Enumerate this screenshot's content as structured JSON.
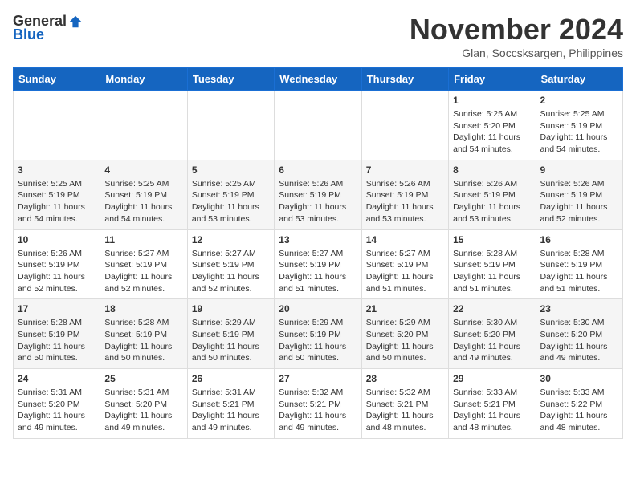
{
  "header": {
    "logo_general": "General",
    "logo_blue": "Blue",
    "month_title": "November 2024",
    "location": "Glan, Soccsksargen, Philippines"
  },
  "weekdays": [
    "Sunday",
    "Monday",
    "Tuesday",
    "Wednesday",
    "Thursday",
    "Friday",
    "Saturday"
  ],
  "weeks": [
    [
      {
        "day": "",
        "info": ""
      },
      {
        "day": "",
        "info": ""
      },
      {
        "day": "",
        "info": ""
      },
      {
        "day": "",
        "info": ""
      },
      {
        "day": "",
        "info": ""
      },
      {
        "day": "1",
        "info": "Sunrise: 5:25 AM\nSunset: 5:20 PM\nDaylight: 11 hours\nand 54 minutes."
      },
      {
        "day": "2",
        "info": "Sunrise: 5:25 AM\nSunset: 5:19 PM\nDaylight: 11 hours\nand 54 minutes."
      }
    ],
    [
      {
        "day": "3",
        "info": "Sunrise: 5:25 AM\nSunset: 5:19 PM\nDaylight: 11 hours\nand 54 minutes."
      },
      {
        "day": "4",
        "info": "Sunrise: 5:25 AM\nSunset: 5:19 PM\nDaylight: 11 hours\nand 54 minutes."
      },
      {
        "day": "5",
        "info": "Sunrise: 5:25 AM\nSunset: 5:19 PM\nDaylight: 11 hours\nand 53 minutes."
      },
      {
        "day": "6",
        "info": "Sunrise: 5:26 AM\nSunset: 5:19 PM\nDaylight: 11 hours\nand 53 minutes."
      },
      {
        "day": "7",
        "info": "Sunrise: 5:26 AM\nSunset: 5:19 PM\nDaylight: 11 hours\nand 53 minutes."
      },
      {
        "day": "8",
        "info": "Sunrise: 5:26 AM\nSunset: 5:19 PM\nDaylight: 11 hours\nand 53 minutes."
      },
      {
        "day": "9",
        "info": "Sunrise: 5:26 AM\nSunset: 5:19 PM\nDaylight: 11 hours\nand 52 minutes."
      }
    ],
    [
      {
        "day": "10",
        "info": "Sunrise: 5:26 AM\nSunset: 5:19 PM\nDaylight: 11 hours\nand 52 minutes."
      },
      {
        "day": "11",
        "info": "Sunrise: 5:27 AM\nSunset: 5:19 PM\nDaylight: 11 hours\nand 52 minutes."
      },
      {
        "day": "12",
        "info": "Sunrise: 5:27 AM\nSunset: 5:19 PM\nDaylight: 11 hours\nand 52 minutes."
      },
      {
        "day": "13",
        "info": "Sunrise: 5:27 AM\nSunset: 5:19 PM\nDaylight: 11 hours\nand 51 minutes."
      },
      {
        "day": "14",
        "info": "Sunrise: 5:27 AM\nSunset: 5:19 PM\nDaylight: 11 hours\nand 51 minutes."
      },
      {
        "day": "15",
        "info": "Sunrise: 5:28 AM\nSunset: 5:19 PM\nDaylight: 11 hours\nand 51 minutes."
      },
      {
        "day": "16",
        "info": "Sunrise: 5:28 AM\nSunset: 5:19 PM\nDaylight: 11 hours\nand 51 minutes."
      }
    ],
    [
      {
        "day": "17",
        "info": "Sunrise: 5:28 AM\nSunset: 5:19 PM\nDaylight: 11 hours\nand 50 minutes."
      },
      {
        "day": "18",
        "info": "Sunrise: 5:28 AM\nSunset: 5:19 PM\nDaylight: 11 hours\nand 50 minutes."
      },
      {
        "day": "19",
        "info": "Sunrise: 5:29 AM\nSunset: 5:19 PM\nDaylight: 11 hours\nand 50 minutes."
      },
      {
        "day": "20",
        "info": "Sunrise: 5:29 AM\nSunset: 5:19 PM\nDaylight: 11 hours\nand 50 minutes."
      },
      {
        "day": "21",
        "info": "Sunrise: 5:29 AM\nSunset: 5:20 PM\nDaylight: 11 hours\nand 50 minutes."
      },
      {
        "day": "22",
        "info": "Sunrise: 5:30 AM\nSunset: 5:20 PM\nDaylight: 11 hours\nand 49 minutes."
      },
      {
        "day": "23",
        "info": "Sunrise: 5:30 AM\nSunset: 5:20 PM\nDaylight: 11 hours\nand 49 minutes."
      }
    ],
    [
      {
        "day": "24",
        "info": "Sunrise: 5:31 AM\nSunset: 5:20 PM\nDaylight: 11 hours\nand 49 minutes."
      },
      {
        "day": "25",
        "info": "Sunrise: 5:31 AM\nSunset: 5:20 PM\nDaylight: 11 hours\nand 49 minutes."
      },
      {
        "day": "26",
        "info": "Sunrise: 5:31 AM\nSunset: 5:21 PM\nDaylight: 11 hours\nand 49 minutes."
      },
      {
        "day": "27",
        "info": "Sunrise: 5:32 AM\nSunset: 5:21 PM\nDaylight: 11 hours\nand 49 minutes."
      },
      {
        "day": "28",
        "info": "Sunrise: 5:32 AM\nSunset: 5:21 PM\nDaylight: 11 hours\nand 48 minutes."
      },
      {
        "day": "29",
        "info": "Sunrise: 5:33 AM\nSunset: 5:21 PM\nDaylight: 11 hours\nand 48 minutes."
      },
      {
        "day": "30",
        "info": "Sunrise: 5:33 AM\nSunset: 5:22 PM\nDaylight: 11 hours\nand 48 minutes."
      }
    ]
  ]
}
